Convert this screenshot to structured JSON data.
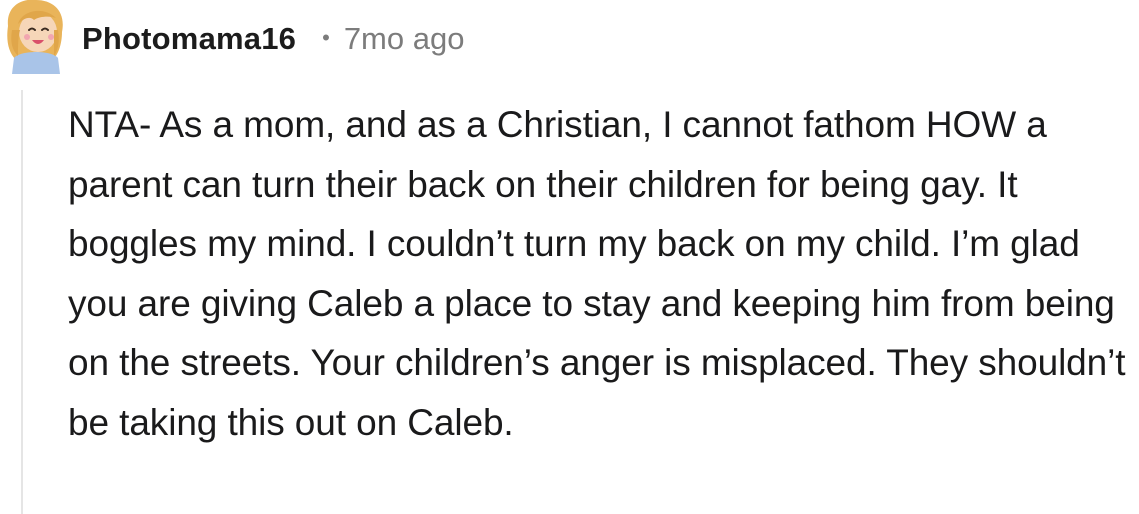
{
  "comment": {
    "author": "Photomama16",
    "separator": "•",
    "timestamp": "7mo ago",
    "avatar_icon": "cartoon-girl-avatar-icon",
    "body": "NTA- As a mom, and as a Christian, I cannot fathom HOW a parent can turn their back on their children for being gay. It boggles my mind. I couldn’t turn my back on my child. I’m glad you are giving Caleb a place to stay and keeping him from being on the streets. Your children’s anger is misplaced. They shouldn’t be taking this out on Caleb."
  },
  "colors": {
    "text": "#1a1a1b",
    "meta": "#7c7c7c",
    "thread_line": "#e5e5e5",
    "hair": "#e9b45a",
    "skin": "#f6d6b8",
    "shirt": "#a9c4e8"
  }
}
